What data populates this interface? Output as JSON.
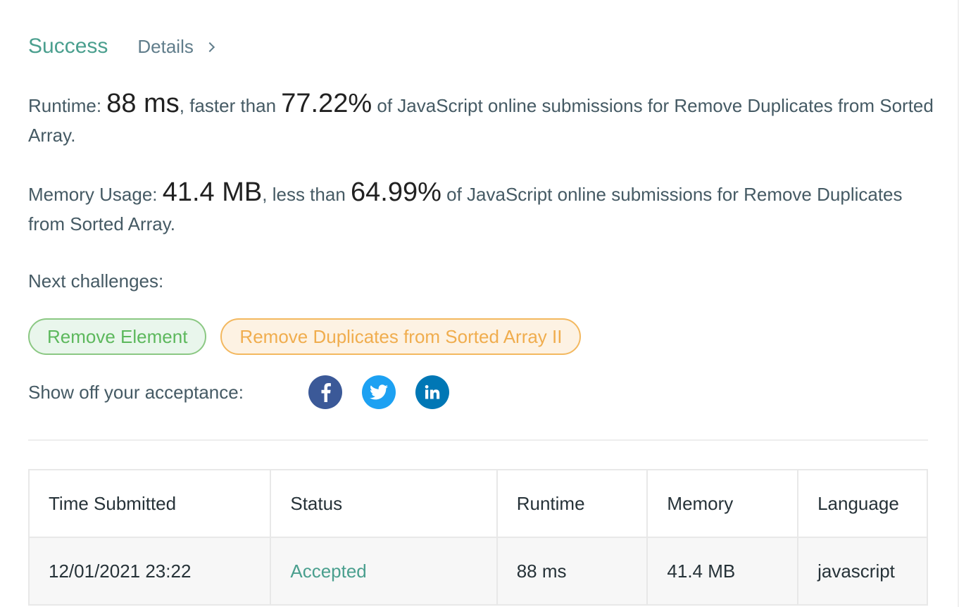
{
  "result": {
    "status": "Success",
    "details_label": "Details",
    "status_color": "#4a9f8e"
  },
  "runtime": {
    "label": "Runtime: ",
    "value": "88 ms",
    "comparison": ", faster than ",
    "percent": "77.22%",
    "suffix": " of JavaScript online submissions for Remove Duplicates from Sorted Array."
  },
  "memory": {
    "label": "Memory Usage: ",
    "value": "41.4 MB",
    "comparison": ", less than ",
    "percent": "64.99%",
    "suffix": " of JavaScript online submissions for Remove Duplicates from Sorted Array."
  },
  "next": {
    "label": "Next challenges:",
    "challenges": [
      {
        "title": "Remove Element",
        "difficulty_color": "#5cb85c"
      },
      {
        "title": "Remove Duplicates from Sorted Array II",
        "difficulty_color": "#f0ad4e"
      }
    ]
  },
  "share": {
    "label": "Show off your acceptance:",
    "icons": [
      "facebook-icon",
      "twitter-icon",
      "linkedin-icon"
    ]
  },
  "table": {
    "headers": [
      "Time Submitted",
      "Status",
      "Runtime",
      "Memory",
      "Language"
    ],
    "rows": [
      [
        "12/01/2021 23:22",
        "Accepted",
        "88 ms",
        "41.4 MB",
        "javascript"
      ]
    ]
  }
}
